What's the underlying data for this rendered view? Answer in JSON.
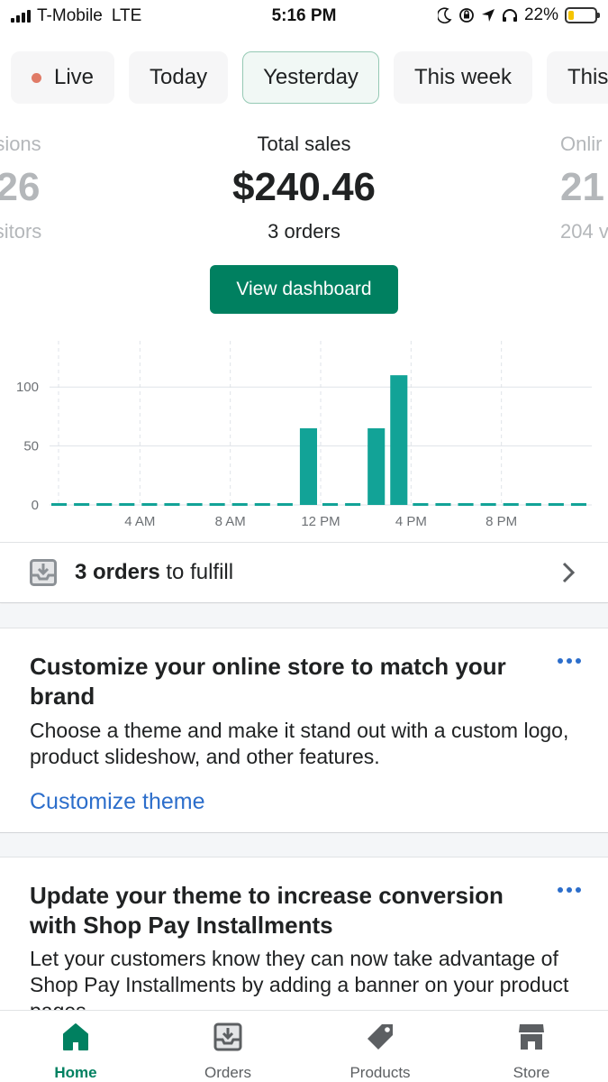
{
  "status_bar": {
    "carrier": "T-Mobile",
    "network": "LTE",
    "time": "5:16 PM",
    "battery_percent": "22%",
    "battery_level": 0.22
  },
  "range_tabs": [
    {
      "label": "Live",
      "active": false
    },
    {
      "label": "Today",
      "active": false
    },
    {
      "label": "Yesterday",
      "active": true
    },
    {
      "label": "This week",
      "active": false
    },
    {
      "label": "This m",
      "active": false
    }
  ],
  "metrics": {
    "left": {
      "label": "sions",
      "value": "26",
      "sub": "sitors"
    },
    "main": {
      "label": "Total sales",
      "value": "$240.46",
      "sub": "3 orders"
    },
    "right": {
      "label": "Onlir",
      "value": "21",
      "sub": "204 v"
    }
  },
  "dashboard_button": "View dashboard",
  "chart_data": {
    "type": "bar",
    "categories": [
      "12 AM",
      "1 AM",
      "2 AM",
      "3 AM",
      "4 AM",
      "5 AM",
      "6 AM",
      "7 AM",
      "8 AM",
      "9 AM",
      "10 AM",
      "11 AM",
      "12 PM",
      "1 PM",
      "2 PM",
      "3 PM",
      "4 PM",
      "5 PM",
      "6 PM",
      "7 PM",
      "8 PM",
      "9 PM",
      "10 PM",
      "11 PM"
    ],
    "values": [
      0,
      0,
      0,
      0,
      0,
      0,
      0,
      0,
      0,
      0,
      0,
      65,
      0,
      0,
      65,
      110,
      0,
      0,
      0,
      0,
      0,
      0,
      0,
      0
    ],
    "y_ticks": [
      0,
      50,
      100
    ],
    "ylim": [
      0,
      130
    ],
    "x_tick_labels": [
      {
        "index": 4,
        "label": "4 AM"
      },
      {
        "index": 8,
        "label": "8 AM"
      },
      {
        "index": 12,
        "label": "12 PM"
      },
      {
        "index": 16,
        "label": "4 PM"
      },
      {
        "index": 20,
        "label": "8 PM"
      }
    ],
    "bar_color": "#12a397",
    "grid": true
  },
  "fulfill": {
    "count_text": "3 orders",
    "rest_text": " to fulfill"
  },
  "cards": [
    {
      "title": "Customize your online store to match your brand",
      "body": "Choose a theme and make it stand out with a custom logo, product slideshow, and other features.",
      "link": "Customize theme"
    },
    {
      "title": "Update your theme to increase conversion with Shop Pay Installments",
      "body": "Let your customers know they can now take advantage of Shop Pay Installments by adding a banner on your product pages."
    }
  ],
  "bottom_nav": [
    {
      "label": "Home",
      "icon": "home-icon",
      "active": true
    },
    {
      "label": "Orders",
      "icon": "orders-icon",
      "active": false
    },
    {
      "label": "Products",
      "icon": "tag-icon",
      "active": false
    },
    {
      "label": "Store",
      "icon": "store-icon",
      "active": false
    }
  ],
  "colors": {
    "accent": "#008060",
    "link": "#2c6ecb",
    "live_dot": "#e07b67"
  }
}
